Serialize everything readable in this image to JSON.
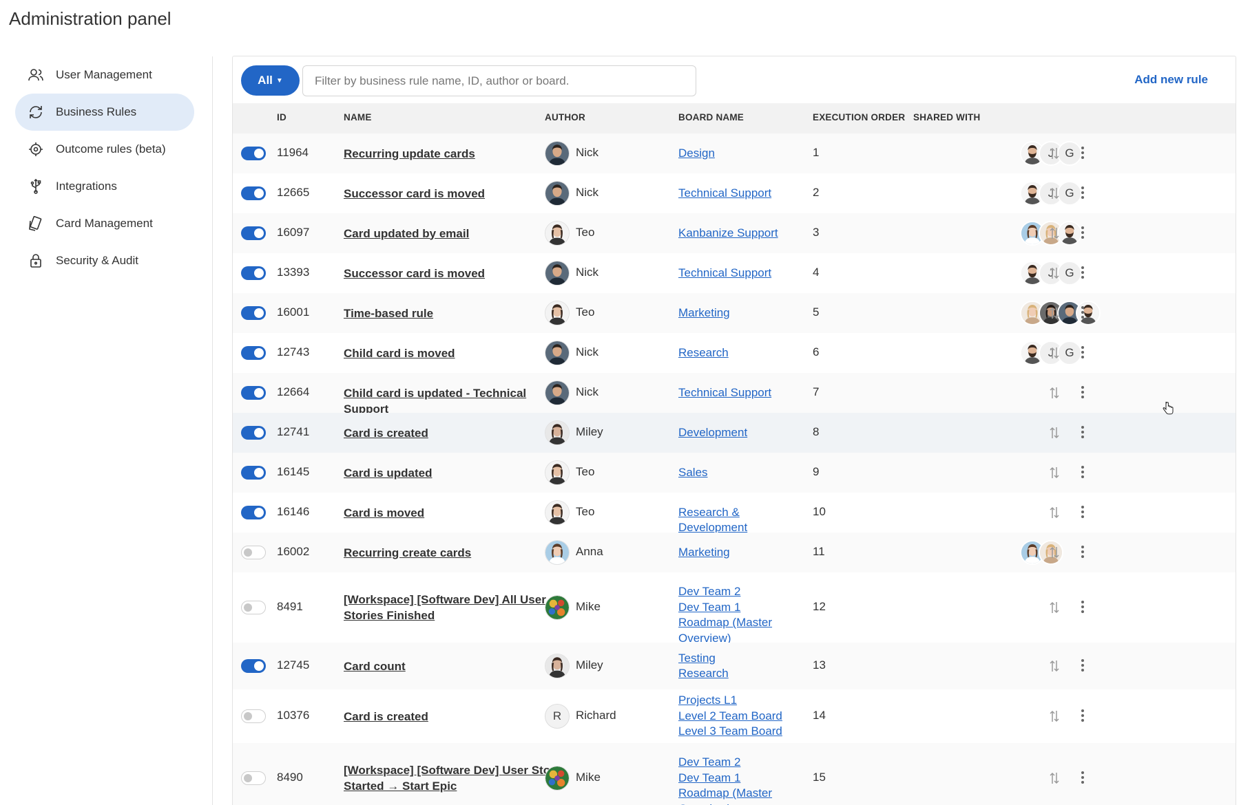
{
  "page": {
    "title": "Administration panel"
  },
  "sidebar": {
    "items": [
      {
        "label": "User Management",
        "icon": "users-icon",
        "active": false
      },
      {
        "label": "Business Rules",
        "icon": "refresh-icon",
        "active": true
      },
      {
        "label": "Outcome rules (beta)",
        "icon": "target-icon",
        "active": false
      },
      {
        "label": "Integrations",
        "icon": "usb-icon",
        "active": false
      },
      {
        "label": "Card Management",
        "icon": "cards-icon",
        "active": false
      },
      {
        "label": "Security & Audit",
        "icon": "lock-icon",
        "active": false
      }
    ]
  },
  "toolbar": {
    "filter_button_label": "All",
    "search_placeholder": "Filter by business rule name, ID, author or board.",
    "add_rule_label": "Add new rule"
  },
  "table": {
    "headers": {
      "id": "ID",
      "name": "NAME",
      "author": "AUTHOR",
      "board": "BOARD NAME",
      "order": "EXECUTION ORDER",
      "shared": "SHARED WITH"
    },
    "rows": [
      {
        "enabled": true,
        "id": "11964",
        "name": "Recurring update cards",
        "author": "Nick",
        "author_avatar": "man-dark",
        "boards": [
          "Design"
        ],
        "order": "1",
        "shared": [
          "man-beard",
          "J",
          "G"
        ]
      },
      {
        "enabled": true,
        "id": "12665",
        "name": "Successor card is moved",
        "author": "Nick",
        "author_avatar": "man-dark",
        "boards": [
          "Technical Support"
        ],
        "order": "2",
        "shared": [
          "man-beard",
          "J",
          "G"
        ]
      },
      {
        "enabled": true,
        "id": "16097",
        "name": "Card updated by email",
        "author": "Teo",
        "author_avatar": "woman-bun",
        "boards": [
          "Kanbanize Support"
        ],
        "order": "3",
        "shared": [
          "woman-blue",
          "woman-blonde",
          "man-beard"
        ]
      },
      {
        "enabled": true,
        "id": "13393",
        "name": "Successor card is moved",
        "author": "Nick",
        "author_avatar": "man-dark",
        "boards": [
          "Technical Support"
        ],
        "order": "4",
        "shared": [
          "man-beard",
          "J",
          "G"
        ]
      },
      {
        "enabled": true,
        "id": "16001",
        "name": "Time-based rule",
        "author": "Teo",
        "author_avatar": "woman-bun",
        "boards": [
          "Marketing"
        ],
        "order": "5",
        "shared": [
          "woman-blonde",
          "woman-dark",
          "man-dark",
          "man-beard"
        ]
      },
      {
        "enabled": true,
        "id": "12743",
        "name": "Child card is moved",
        "author": "Nick",
        "author_avatar": "man-dark",
        "boards": [
          "Research"
        ],
        "order": "6",
        "shared": [
          "man-beard",
          "J",
          "G"
        ]
      },
      {
        "enabled": true,
        "id": "12664",
        "name": "Child card is updated - Technical Support",
        "author": "Nick",
        "author_avatar": "man-dark",
        "boards": [
          "Technical Support"
        ],
        "order": "7",
        "shared": []
      },
      {
        "enabled": true,
        "id": "12741",
        "name": "Card is created",
        "author": "Miley",
        "author_avatar": "woman-curly",
        "boards": [
          "Development"
        ],
        "order": "8",
        "shared": []
      },
      {
        "enabled": true,
        "id": "16145",
        "name": "Card is updated",
        "author": "Teo",
        "author_avatar": "woman-bun",
        "boards": [
          "Sales"
        ],
        "order": "9",
        "shared": []
      },
      {
        "enabled": true,
        "id": "16146",
        "name": "Card is moved",
        "author": "Teo",
        "author_avatar": "woman-bun",
        "boards": [
          "Research & Development"
        ],
        "order": "10",
        "shared": []
      },
      {
        "enabled": false,
        "id": "16002",
        "name": "Recurring create cards",
        "author": "Anna",
        "author_avatar": "woman-blue",
        "boards": [
          "Marketing"
        ],
        "order": "11",
        "shared": [
          "woman-blue",
          "woman-blonde"
        ]
      },
      {
        "enabled": false,
        "id": "8491",
        "name": "[Workspace] [Software Dev] All User Stories Finished",
        "author": "Mike",
        "author_avatar": "mosaic",
        "boards": [
          "Dev Team 2",
          "Dev Team 1",
          "Roadmap (Master Overview)"
        ],
        "order": "12",
        "shared": []
      },
      {
        "enabled": true,
        "id": "12745",
        "name": "Card count",
        "author": "Miley",
        "author_avatar": "woman-curly",
        "boards": [
          "Testing",
          "Research"
        ],
        "order": "13",
        "shared": []
      },
      {
        "enabled": false,
        "id": "10376",
        "name": "Card is created",
        "author": "Richard",
        "author_avatar": "R",
        "boards": [
          "Projects L1",
          "Level 2 Team Board",
          "Level 3 Team Board"
        ],
        "order": "14",
        "shared": []
      },
      {
        "enabled": false,
        "id": "8490",
        "name": "[Workspace] [Software Dev] User Story Started → Start Epic",
        "author": "Mike",
        "author_avatar": "mosaic",
        "boards": [
          "Dev Team 2",
          "Dev Team 1",
          "Roadmap (Master Overview)"
        ],
        "order": "15",
        "shared": []
      }
    ]
  },
  "colors": {
    "accent": "#2266c6",
    "active_nav": "#e1ebf8",
    "header_bg": "#f2f2f2"
  }
}
